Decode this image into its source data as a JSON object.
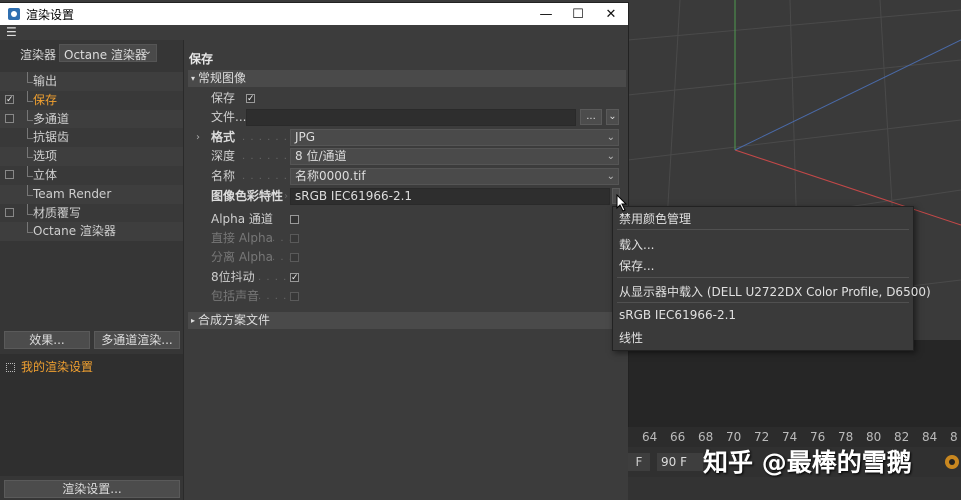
{
  "window": {
    "title": "渲染设置",
    "controls": {
      "minimize": "—",
      "maximize": "☐",
      "close": "✕"
    }
  },
  "left": {
    "renderer_label": "渲染器",
    "renderer_value": "Octane 渲染器",
    "tree": [
      {
        "label": "输出",
        "checkbox": false,
        "checked": false,
        "active": false
      },
      {
        "label": "保存",
        "checkbox": true,
        "checked": true,
        "active": true
      },
      {
        "label": "多通道",
        "checkbox": true,
        "checked": false,
        "active": false
      },
      {
        "label": "抗锯齿",
        "checkbox": false,
        "checked": false,
        "active": false
      },
      {
        "label": "选项",
        "checkbox": false,
        "checked": false,
        "active": false
      },
      {
        "label": "立体",
        "checkbox": true,
        "checked": false,
        "active": false
      },
      {
        "label": "Team Render",
        "checkbox": false,
        "checked": false,
        "active": false
      },
      {
        "label": "材质覆写",
        "checkbox": true,
        "checked": false,
        "active": false
      },
      {
        "label": "Octane 渲染器",
        "checkbox": false,
        "checked": false,
        "active": false
      }
    ],
    "effects_button": "效果...",
    "multipass_button": "多通道渲染...",
    "preset": "我的渲染设置",
    "render_settings_button": "渲染设置..."
  },
  "right": {
    "section_title": "保存",
    "group_regular": "常规图像",
    "save_label": "保存",
    "save_checked": true,
    "file_label": "文件...",
    "file_value": "",
    "file_btn": "...",
    "format_label": "格式",
    "format_value": "JPG",
    "depth_label": "深度",
    "depth_value": "8 位/通道",
    "name_label": "名称",
    "name_value": "名称0000.tif",
    "colorprofile_label": "图像色彩特性",
    "colorprofile_value": "sRGB IEC61966-2.1",
    "alpha_label": "Alpha 通道",
    "straight_alpha_label": "直接 Alpha",
    "separate_alpha_label": "分离 Alpha",
    "dither_label": "8位抖动",
    "dither_checked": true,
    "sound_label": "包括声音",
    "group_compositing": "合成方案文件"
  },
  "popup": {
    "items": [
      "禁用颜色管理",
      "载入...",
      "保存...",
      "从显示器中载入 (DELL U2722DX Color Profile, D6500)",
      "sRGB IEC61966-2.1",
      "线性"
    ]
  },
  "timeline": {
    "ticks": [
      "64",
      "66",
      "68",
      "70",
      "72",
      "74",
      "76",
      "78",
      "80",
      "82",
      "84",
      "8"
    ],
    "frame_f": "F",
    "frame_end": "90 F"
  },
  "watermark": "知乎 @最棒的雪鹅",
  "colors": {
    "accent": "#f0a030",
    "panel": "#3c3c3c",
    "title_bar": "#ffffff"
  }
}
